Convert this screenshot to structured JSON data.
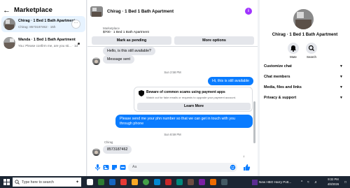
{
  "left": {
    "title": "Marketplace",
    "conversations": [
      {
        "title": "Chirag · 1 Bed 1 Bath Apartment",
        "preview": "Chirag: 8573187462 · 15h"
      },
      {
        "title": "Wanda · 1 Bed 1 Bath Apartment",
        "preview": "You: Please confirm me, are you sti... · 1d"
      }
    ],
    "more_label": "···"
  },
  "thread": {
    "title": "Chirag · 1 Bed 1 Bath Apartment",
    "listing_label": "Marketplace",
    "listing_price": "$700 · 1 Bed 1 Bath Apartment",
    "mark_pending": "Mark as pending",
    "more_options": "More options",
    "messages": {
      "in1": "Hello, is this still available?",
      "in2": "Message sent",
      "ts1": "Sun 2:58 PM",
      "out1": "Hi, this is still available",
      "scam_title": "Beware of common scams using payment apps",
      "scam_body": "Watch out for fake emails or requests to upgrade your payment account.",
      "learn_more": "Learn More",
      "out2": "Please send me your phn number so that we can get in touch with you through phone",
      "ts2": "Sun 8:59 PM",
      "sender": "Chirag",
      "in3": "8573187462",
      "seen": "↓"
    },
    "composer_placeholder": "Aa"
  },
  "details": {
    "title": "Chirag · 1 Bed 1 Bath Apartment",
    "mute": "Mute",
    "search": "Search",
    "sections": [
      "Customize chat",
      "Chat members",
      "Media, files and links",
      "Privacy & support"
    ]
  },
  "taskbar": {
    "search_placeholder": "Type here to search",
    "app_label": "New HBO Harry Pott...",
    "time": "9:32 PM",
    "date": "4/8/2026"
  },
  "colors": {
    "accent": "#0a7cff",
    "info": "#a033ff",
    "taskbar": "#1c2633"
  }
}
